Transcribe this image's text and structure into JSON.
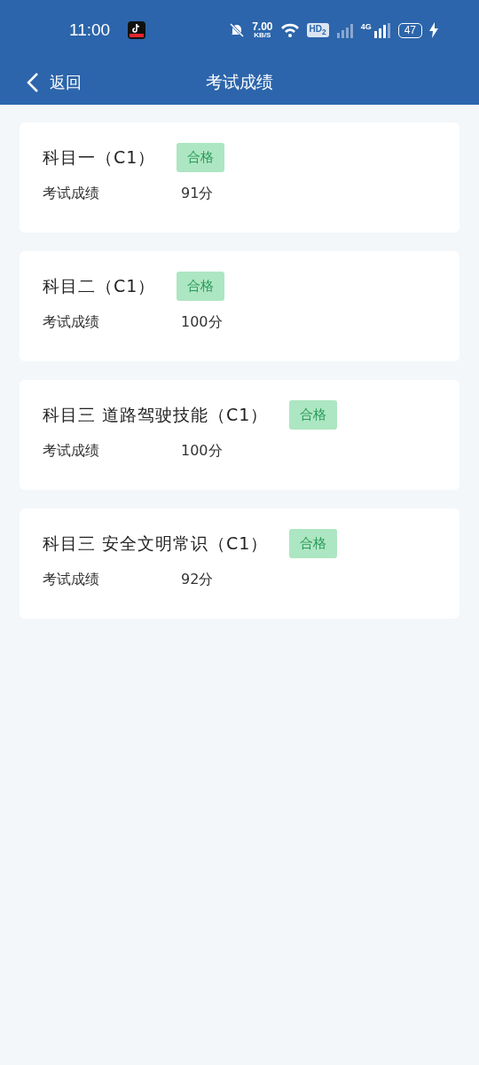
{
  "status_bar": {
    "time": "11:00",
    "net_speed": "7.00",
    "net_unit": "KB/S",
    "hd": "HD$_{2}$",
    "network": "4G",
    "battery": "47"
  },
  "nav": {
    "back": "返回",
    "title": "考试成绩"
  },
  "results": [
    {
      "subject": "科目一（C1）",
      "badge": "合格",
      "label": "考试成绩",
      "score": "91分"
    },
    {
      "subject": "科目二（C1）",
      "badge": "合格",
      "label": "考试成绩",
      "score": "100分"
    },
    {
      "subject": "科目三 道路驾驶技能（C1）",
      "badge": "合格",
      "label": "考试成绩",
      "score": "100分"
    },
    {
      "subject": "科目三 安全文明常识（C1）",
      "badge": "合格",
      "label": "考试成绩",
      "score": "92分"
    }
  ]
}
